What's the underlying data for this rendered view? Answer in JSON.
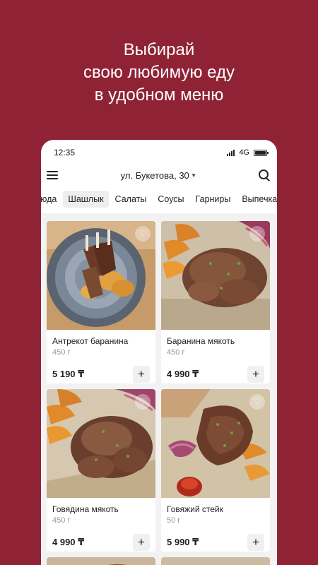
{
  "promo": {
    "line1": "Выбирай",
    "line2": "свою любимую еду",
    "line3": "в удобном меню"
  },
  "status_bar": {
    "time": "12:35",
    "network": "4G"
  },
  "header": {
    "address": "ул. Букетова, 30",
    "menu_icon": "hamburger-icon",
    "search_icon": "search-icon"
  },
  "categories": [
    {
      "label": "юда",
      "active": false
    },
    {
      "label": "Шашлык",
      "active": true
    },
    {
      "label": "Салаты",
      "active": false
    },
    {
      "label": "Соусы",
      "active": false
    },
    {
      "label": "Гарниры",
      "active": false
    },
    {
      "label": "Выпечка",
      "active": false
    }
  ],
  "products": [
    {
      "name": "Антрекот баранина",
      "weight": "450 г",
      "price": "5 190 ₸"
    },
    {
      "name": "Баранина мякоть",
      "weight": "450 г",
      "price": "4 990 ₸"
    },
    {
      "name": "Говядина мякоть",
      "weight": "450 г",
      "price": "4 990 ₸"
    },
    {
      "name": "Говяжий стейк",
      "weight": "50 г",
      "price": "5 990 ₸"
    }
  ],
  "add_label": "+",
  "colors": {
    "background": "#8f2335",
    "card": "#ffffff",
    "grid_background": "#f2f2f2"
  }
}
